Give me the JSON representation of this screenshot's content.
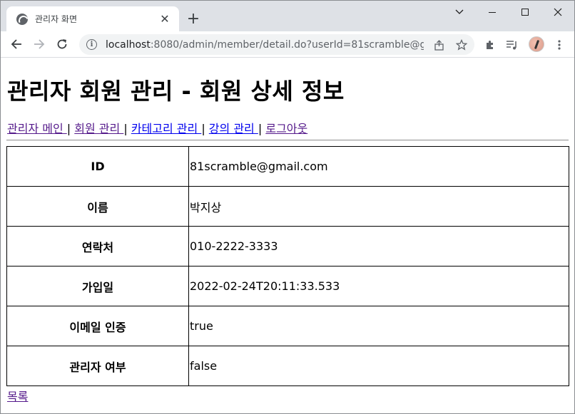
{
  "browser": {
    "tab_title": "관리자 화면",
    "tab_close": "✕",
    "new_tab": "+",
    "url_host": "localhost",
    "url_rest": ":8080/admin/member/detail.do?userId=81scramble@gmail.c...",
    "icons": [
      "globe-icon",
      "back-arrow-icon",
      "forward-arrow-icon",
      "reload-icon",
      "info-icon",
      "share-icon",
      "star-icon",
      "extensions-icon",
      "media-icon",
      "avatar",
      "menu-icon"
    ]
  },
  "page": {
    "title": "관리자 회원 관리 - 회원 상세 정보",
    "nav": [
      {
        "label": "관리자 메인 ",
        "visited": true
      },
      {
        "label": "회원 관리 ",
        "visited": true
      },
      {
        "label": "카테고리 관리 ",
        "visited": false
      },
      {
        "label": "강의 관리 ",
        "visited": false
      },
      {
        "label": "로그아웃",
        "visited": true
      }
    ],
    "nav_sep": "|",
    "rows": [
      {
        "label": "ID",
        "value": "81scramble@gmail.com"
      },
      {
        "label": "이름",
        "value": "박지상"
      },
      {
        "label": "연락처",
        "value": "010-2222-3333"
      },
      {
        "label": "가입일",
        "value": "2022-02-24T20:11:33.533"
      },
      {
        "label": "이메일 인증",
        "value": "true"
      },
      {
        "label": "관리자 여부",
        "value": "false"
      }
    ],
    "back_link": "목록"
  },
  "colors": {
    "link": "#0000ee",
    "visited_link": "#551a8b",
    "tabstrip": "#dee1e6",
    "omnibox": "#f1f3f4"
  }
}
